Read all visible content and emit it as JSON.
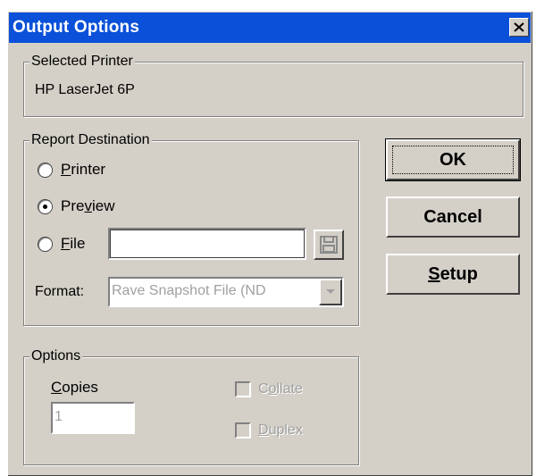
{
  "window": {
    "title": "Output Options",
    "close_glyph": "✕"
  },
  "selected_printer": {
    "legend": "Selected Printer",
    "name": "HP LaserJet 6P"
  },
  "report_destination": {
    "legend": "Report Destination",
    "options": [
      {
        "label": "Printer",
        "mnemonic": "P",
        "rest": "rinter",
        "checked": false
      },
      {
        "label": "Preview",
        "mnemonic_prefix": "Pre",
        "mnemonic": "v",
        "rest": "iew",
        "checked": true
      },
      {
        "label": "File",
        "mnemonic": "F",
        "rest": "ile",
        "checked": false
      }
    ],
    "file_path": "",
    "format_label": "Format:",
    "format_value": "Rave Snapshot File (ND"
  },
  "buttons": {
    "ok": "OK",
    "cancel": "Cancel",
    "setup_mnemonic": "S",
    "setup_rest": "etup"
  },
  "options": {
    "legend": "Options",
    "copies_mnemonic": "C",
    "copies_rest": "opies",
    "copies_value": "1",
    "collate_prefix": "C",
    "collate_mnemonic": "o",
    "collate_rest": "llate",
    "duplex_mnemonic": "D",
    "duplex_rest": "uplex"
  },
  "icons": {
    "close": "close-icon",
    "save": "floppy-disk-icon",
    "dropdown": "chevron-down-icon"
  },
  "colors": {
    "titlebar": "#0a50d8",
    "face": "#d4d0c8",
    "disabled": "#a0a0a0"
  }
}
